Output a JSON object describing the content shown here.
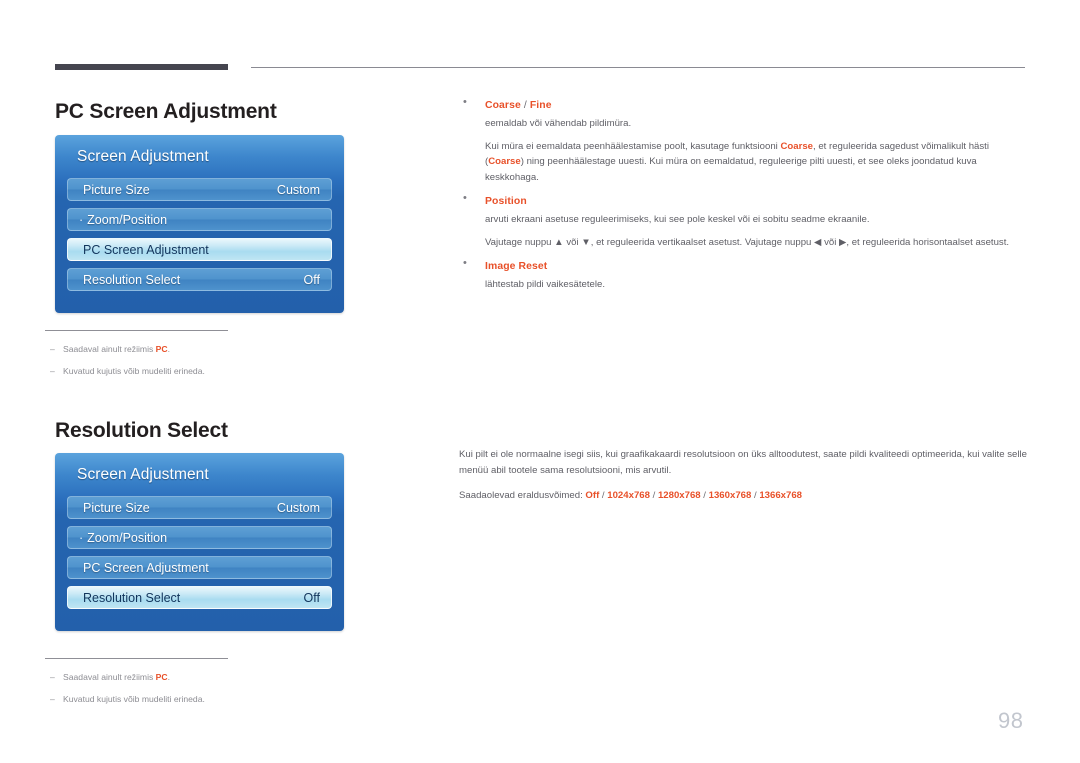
{
  "page": {
    "number": "98"
  },
  "sections": [
    {
      "heading": "PC Screen Adjustment",
      "osd": {
        "title": "Screen Adjustment",
        "rows": [
          {
            "label": "Picture Size",
            "value": "Custom",
            "bullet": "",
            "selected": false
          },
          {
            "label": "Zoom/Position",
            "value": "",
            "bullet": "·",
            "selected": false
          },
          {
            "label": "PC Screen Adjustment",
            "value": "",
            "bullet": "",
            "selected": true
          },
          {
            "label": "Resolution Select",
            "value": "Off",
            "bullet": "",
            "selected": false
          }
        ]
      },
      "footnotes": [
        {
          "pre": "Saadaval ainult režiimis ",
          "strong": "PC",
          "post": "."
        },
        {
          "pre": "Kuvatud kujutis võib mudeliti erineda.",
          "strong": "",
          "post": ""
        }
      ]
    },
    {
      "heading": "Resolution Select",
      "osd": {
        "title": "Screen Adjustment",
        "rows": [
          {
            "label": "Picture Size",
            "value": "Custom",
            "bullet": "",
            "selected": false
          },
          {
            "label": "Zoom/Position",
            "value": "",
            "bullet": "·",
            "selected": false
          },
          {
            "label": "PC Screen Adjustment",
            "value": "",
            "bullet": "",
            "selected": false
          },
          {
            "label": "Resolution Select",
            "value": "Off",
            "bullet": "",
            "selected": true
          }
        ]
      },
      "footnotes": [
        {
          "pre": "Saadaval ainult režiimis ",
          "strong": "PC",
          "post": "."
        },
        {
          "pre": "Kuvatud kujutis võib mudeliti erineda.",
          "strong": "",
          "post": ""
        }
      ]
    }
  ],
  "right_column": {
    "bullets": [
      {
        "title_main": "Coarse",
        "title_sep": " / ",
        "title_second": "Fine",
        "paragraphs": [
          "eemaldab või vähendab pildimüra.",
          "Kui müra ei eemaldata peenhäälestamise poolt, kasutage funktsiooni Coarse, et reguleerida sagedust võimalikult hästi (Coarse) ning peenhäälestage uuesti. Kui müra on eemaldatud, reguleerige pilti uuesti, et see oleks joondatud kuva keskkohaga."
        ]
      },
      {
        "title_main": "Position",
        "title_sep": "",
        "title_second": "",
        "paragraphs": [
          "arvuti ekraani asetuse reguleerimiseks, kui see pole keskel või ei sobitu seadme ekraanile.",
          "Vajutage nuppu ▲ või ▼, et reguleerida vertikaalset asetust. Vajutage nuppu ◀ või ▶, et reguleerida horisontaalset asetust."
        ]
      },
      {
        "title_main": "Image Reset",
        "title_sep": "",
        "title_second": "",
        "paragraphs": [
          "lähtestab pildi vaikesätetele."
        ]
      }
    ],
    "bottom": {
      "paragraph": "Kui pilt ei ole normaalne isegi siis, kui graafikakaardi resolutsioon on üks alltoodutest, saate pildi kvaliteedi optimeerida, kui valite selle menüü abil tootele sama resolutsiooni, mis arvutil.",
      "resolutions_label": "Saadaolevad eraldusvõimed: ",
      "resolutions": [
        "Off",
        "1024x768",
        "1280x768",
        "1360x768",
        "1366x768"
      ],
      "resolutions_separator": " / "
    }
  },
  "colors": {
    "accent_orange": "#e8512a",
    "osd_blue": "#2565b0",
    "osd_blue_light": "#5ba3dd",
    "rule_dark": "#45454f",
    "body_gray": "#5f5f66",
    "page_number": "#c2c6ce"
  }
}
